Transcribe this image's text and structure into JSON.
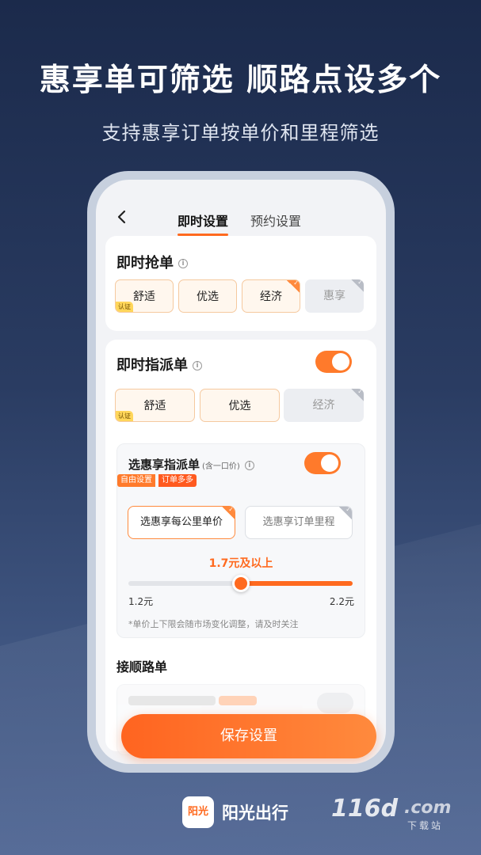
{
  "promo": {
    "headline": "惠享单可筛选  顺路点设多个",
    "subline": "支持惠享订单按单价和里程筛选"
  },
  "tabs": [
    {
      "label": "即时设置",
      "active": true
    },
    {
      "label": "预约设置",
      "active": false
    }
  ],
  "instant_grab": {
    "title": "即时抢单",
    "chips": [
      {
        "label": "舒适",
        "selected": true,
        "badge": "认证"
      },
      {
        "label": "优选",
        "selected": true
      },
      {
        "label": "经济",
        "selected": true,
        "check": true
      },
      {
        "label": "惠享",
        "selected": false,
        "check": true
      }
    ]
  },
  "instant_dispatch": {
    "title": "即时指派单",
    "enabled": true,
    "chips": [
      {
        "label": "舒适",
        "selected": true,
        "badge": "认证"
      },
      {
        "label": "优选",
        "selected": true
      },
      {
        "label": "经济",
        "selected": false,
        "check": true
      }
    ]
  },
  "huixiang_dispatch": {
    "title": "选惠享指派单",
    "note": "(含一口价)",
    "enabled": true,
    "tag_left": "自由设置",
    "tag_right": "订单多多",
    "options": [
      {
        "label": "选惠享每公里单价",
        "selected": true
      },
      {
        "label": "选惠享订单里程",
        "selected": false
      }
    ],
    "slider": {
      "value_label": "1.7元及以上",
      "min_label": "1.2元",
      "max_label": "2.2元",
      "value": 0.5
    },
    "disclaimer": "*单价上下限会随市场变化调整，请及时关注"
  },
  "route_section": {
    "title": "接顺路单"
  },
  "save_button": "保存设置",
  "brand": {
    "logo_text": "阳光",
    "name": "阳光出行"
  },
  "watermark": {
    "main": "116d",
    "suffix": ".com",
    "sub": "下载站"
  },
  "colors": {
    "accent": "#ff6a1f",
    "background": "#1b2a4b"
  }
}
